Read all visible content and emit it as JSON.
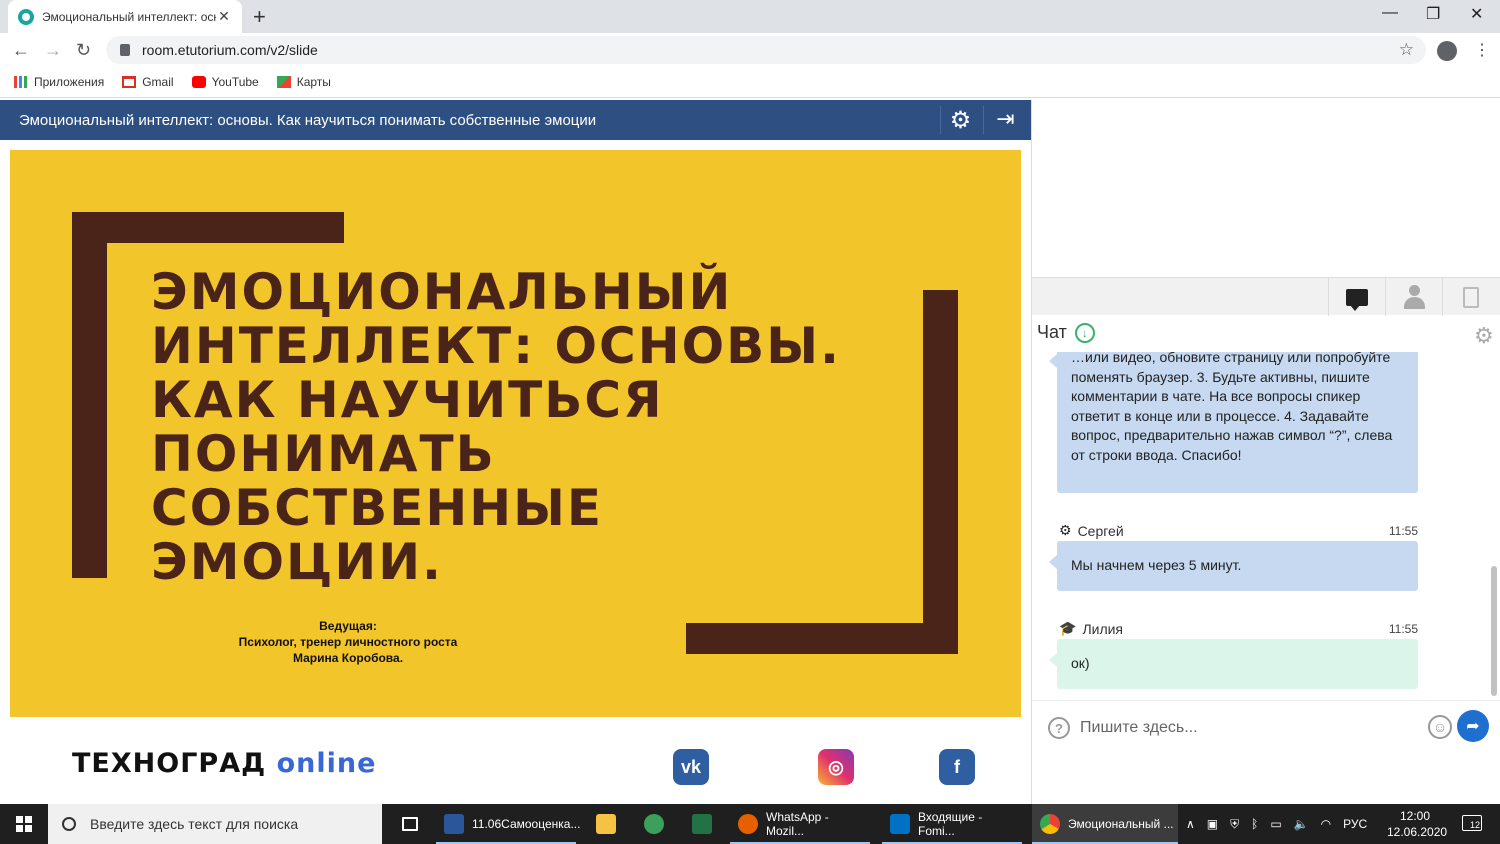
{
  "browser": {
    "tab_title": "Эмоциональный интеллект: осн",
    "tab_close": "✕",
    "new_tab": "+",
    "url": "room.etutorium.com/v2/slide",
    "win_min": "—",
    "win_max": "❐",
    "win_close": "✕",
    "nav_back": "←",
    "nav_forward": "→",
    "nav_reload": "↻",
    "star": "☆",
    "menu": "⋮",
    "bookmarks": [
      "Приложения",
      "Gmail",
      "YouTube",
      "Карты"
    ]
  },
  "page": {
    "header_title": "Эмоциональный интеллект: основы. Как научиться понимать собственные эмоции",
    "settings_icon": "⚙",
    "exit_icon": "⇥"
  },
  "slide": {
    "title_lines": [
      "ЭМОЦИОНАЛЬНЫЙ",
      "ИНТЕЛЛЕКТ: ОСНОВЫ.",
      "КАК НАУЧИТЬСЯ",
      "ПОНИМАТЬ",
      "СОБСТВЕННЫЕ",
      "ЭМОЦИИ."
    ],
    "host_label": "Ведущая:",
    "host_role": "Психолог, тренер личностного роста",
    "host_name": "Марина Коробова.",
    "bg_color": "#f2c52b",
    "frame_color": "#4a2418"
  },
  "footer": {
    "logo_main": "ТЕХНОГРАД",
    "logo_online": "online",
    "social": [
      "vk",
      "instagram",
      "facebook"
    ]
  },
  "chat": {
    "title": "Чат",
    "download_icon": "↓",
    "gear_icon": "⚙",
    "messages": [
      {
        "author": "",
        "time": "",
        "text": "…или видео, обновите страницу или попробуйте поменять браузер. 3. Будьте активны, пишите комментарии в чате. На все вопросы спикер ответит в конце или в процессе. 4. Задавайте вопрос, предварительно нажав символ “?”, слева от строки ввода. Спасибо!"
      },
      {
        "author": "Сергей",
        "time": "11:55",
        "text": "Мы начнем через 5 минут.",
        "icon": "⚙"
      },
      {
        "author": "Лилия",
        "time": "11:55",
        "text": "ок)",
        "icon": "🎓"
      }
    ],
    "input_placeholder": "Пишите здесь...",
    "question_icon": "?",
    "smile_icon": "☺",
    "send_icon": "➦"
  },
  "taskbar": {
    "search_placeholder": "Введите здесь текст для поиска",
    "items": [
      "11.06Самооценка...",
      "WhatsApp - Mozil...",
      "Входящие - Fomi...",
      "Эмоциональный ..."
    ],
    "language": "РУС",
    "time": "12:00",
    "date": "12.06.2020",
    "notifications": "12"
  }
}
